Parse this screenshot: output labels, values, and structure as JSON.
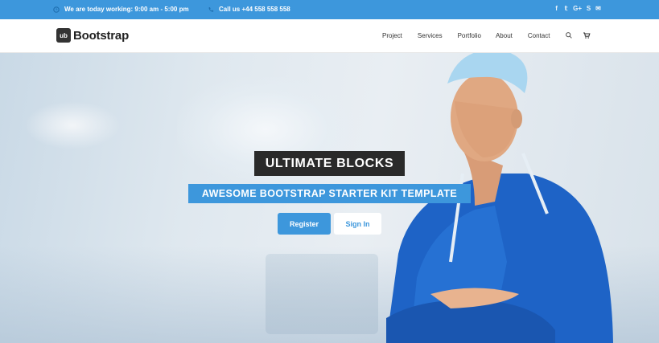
{
  "topbar": {
    "hours_text": "We are today working: 9:00 am - 5:00 pm",
    "phone_text": "Call us +44 558 558 558",
    "social_icons": [
      "facebook-icon",
      "twitter-icon",
      "google-plus-icon",
      "skype-icon",
      "mail-icon"
    ],
    "social_glyphs": [
      "f",
      "𝕥",
      "G+",
      "S",
      "✉"
    ],
    "background": "#3d97dc"
  },
  "navbar": {
    "logo_mark": "ub",
    "logo_text": "Bootstrap",
    "menu": {
      "project": "Project",
      "services": "Services",
      "portfolio": "Portfolio",
      "about": "About",
      "contact": "Contact"
    },
    "icons": [
      "search-icon",
      "cart-icon"
    ]
  },
  "hero": {
    "title": "ULTIMATE BLOCKS",
    "subtitle": "AWESOME BOOTSTRAP STARTER KIT TEMPLATE",
    "register_label": "Register",
    "signin_label": "Sign In",
    "accent_color": "#3d97dc",
    "title_bg": "#2a2a2a"
  }
}
